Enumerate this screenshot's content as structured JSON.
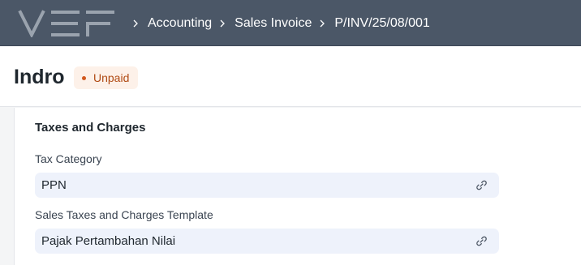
{
  "navbar": {
    "logo_text": "VEF",
    "breadcrumbs": [
      {
        "label": "Accounting"
      },
      {
        "label": "Sales Invoice"
      },
      {
        "label": "P/INV/25/08/001"
      }
    ]
  },
  "header": {
    "title": "Indro",
    "status": "Unpaid"
  },
  "section": {
    "title": "Taxes and Charges",
    "fields": [
      {
        "label": "Tax Category",
        "value": "PPN"
      },
      {
        "label": "Sales Taxes and Charges Template",
        "value": "Pajak Pertambahan Nilai"
      }
    ]
  },
  "colors": {
    "navbar": "#4b5767",
    "status_text": "#b04a13",
    "status_bg": "#fdf1e9",
    "field_bg": "#eef2fb"
  },
  "icons": [
    "chevron-right-icon",
    "link-icon"
  ]
}
